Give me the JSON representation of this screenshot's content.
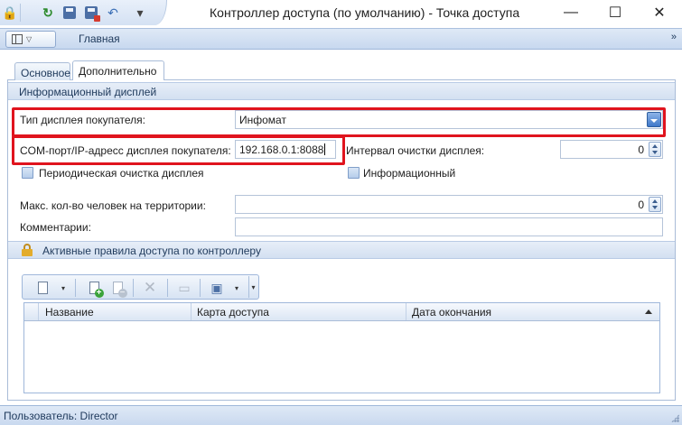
{
  "window": {
    "title": "Контроллер доступа (по умолчанию)  - Точка доступа",
    "minimize_glyph": "—",
    "maximize_glyph": "☐",
    "close_glyph": "✕"
  },
  "quick_access": {
    "icons": [
      "lock-icon",
      "refresh-icon",
      "save-icon",
      "save-and-close-icon",
      "undo-icon",
      "customize-menu-icon"
    ]
  },
  "ribbon": {
    "tab_label": "Главная",
    "expand_glyph": "»"
  },
  "tabs": [
    {
      "label": "Основное",
      "active": false
    },
    {
      "label": "Дополнительно",
      "active": true
    }
  ],
  "info_display": {
    "header": "Информационный дисплей",
    "buyer_display_type": {
      "label": "Тип дисплея покупателя:",
      "value": "Инфомат"
    },
    "com_port": {
      "label": "COM-порт/IP-адресс дисплея покупателя:",
      "value": "192.168.0.1:8088"
    },
    "clear_interval": {
      "label": "Интервал очистки дисплея:",
      "value": "0"
    },
    "periodic_clear": {
      "label": "Периодическая очистка дисплея",
      "checked": false
    },
    "informational": {
      "label": "Информационный",
      "checked": false
    }
  },
  "max_people": {
    "label": "Макс. кол-во человек на территории:",
    "value": "0"
  },
  "comments": {
    "label": "Комментарии:",
    "value": ""
  },
  "access_rules": {
    "header": "Активные правила доступа по контроллеру",
    "toolbar_icons": [
      "new-document-icon",
      "add-icon",
      "remove-icon",
      "delete-icon",
      "edit-icon",
      "print-icon",
      "toolbar-options-icon"
    ],
    "columns": [
      "Название",
      "Карта доступа",
      "Дата окончания"
    ],
    "rows": []
  },
  "statusbar": {
    "user": "Пользователь: Director"
  },
  "colors": {
    "highlight": "#e0141e",
    "ribbon_text": "#1e395b",
    "accent": "#3f78c9"
  }
}
